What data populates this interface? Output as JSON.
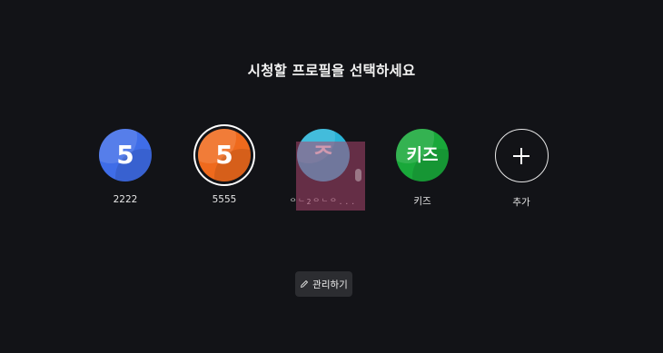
{
  "header": {
    "title": "시청할 프로필을 선택하세요"
  },
  "profiles": [
    {
      "name": "2222",
      "avatar_text": "5",
      "color": "#3f6de8",
      "selected": false
    },
    {
      "name": "5555",
      "avatar_text": "5",
      "color": "#ef6a1d",
      "selected": true
    },
    {
      "name": "ᄋᄂ2ᄋᄂᄋ...",
      "avatar_text": "ᄌ",
      "color": "#2ab3d6",
      "selected": false
    },
    {
      "name": "키즈",
      "avatar_text": "키즈",
      "color": "#19a83a",
      "selected": false
    }
  ],
  "add_profile": {
    "label": "추가",
    "icon": "plus-icon"
  },
  "manage_button": {
    "label": "관리하기",
    "icon": "pencil-icon"
  },
  "colors": {
    "background": "#121317",
    "button_bg": "#2c2d31",
    "overlay": "#aa466e"
  }
}
